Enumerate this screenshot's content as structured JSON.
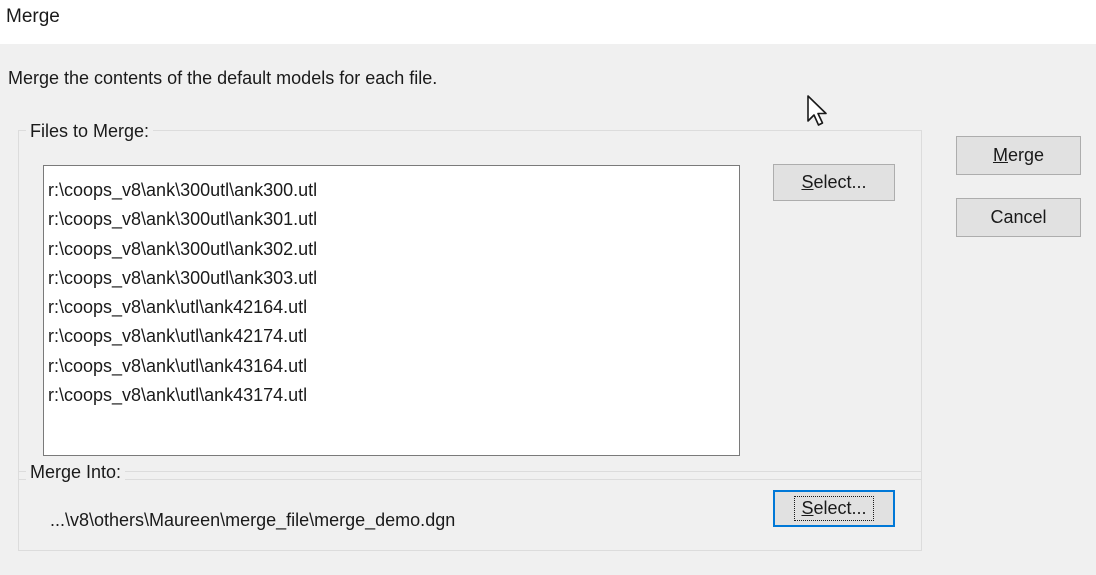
{
  "window": {
    "title": "Merge"
  },
  "description": "Merge the contents of the default models for each file.",
  "files_to_merge": {
    "label": "Files to Merge:",
    "items": [
      "r:\\coops_v8\\ank\\300utl\\ank300.utl",
      "r:\\coops_v8\\ank\\300utl\\ank301.utl",
      "r:\\coops_v8\\ank\\300utl\\ank302.utl",
      "r:\\coops_v8\\ank\\300utl\\ank303.utl",
      "r:\\coops_v8\\ank\\utl\\ank42164.utl",
      "r:\\coops_v8\\ank\\utl\\ank42174.utl",
      "r:\\coops_v8\\ank\\utl\\ank43164.utl",
      "r:\\coops_v8\\ank\\utl\\ank43174.utl"
    ],
    "select_button": {
      "mnemonic": "S",
      "rest": "elect..."
    }
  },
  "merge_into": {
    "label": "Merge Into:",
    "path": "...\\v8\\others\\Maureen\\merge_file\\merge_demo.dgn",
    "select_button": {
      "mnemonic": "S",
      "rest": "elect..."
    }
  },
  "buttons": {
    "merge": {
      "mnemonic": "M",
      "rest": "erge"
    },
    "cancel": "Cancel"
  },
  "icons": {
    "cursor": "mouse-pointer-icon"
  }
}
